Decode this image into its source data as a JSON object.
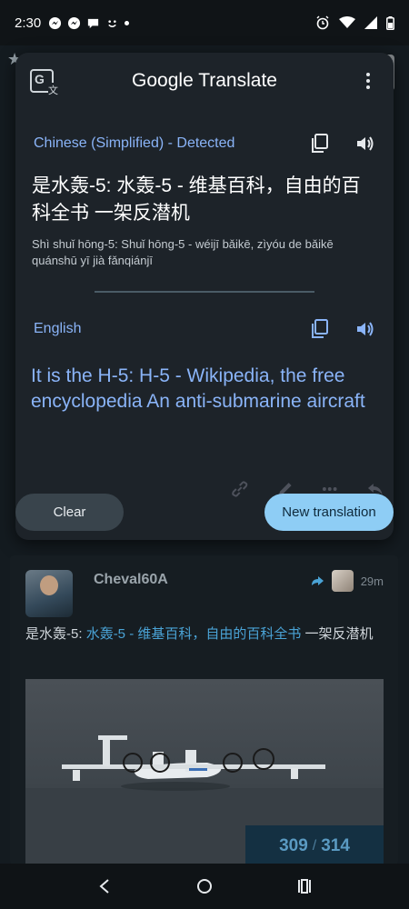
{
  "status_bar": {
    "time": "2:30"
  },
  "translate": {
    "app_name_bold": "Google",
    "app_name_rest": " Translate",
    "source_language": "Chinese (Simplified) - Detected",
    "source_text": "是水轰-5: 水轰-5 - 维基百科，自由的百科全书 一架反潜机",
    "pinyin": "Shì shuǐ hōng-5: Shuǐ hōng-5 - wéijī bǎikē, zìyóu de bǎikē quánshū yī jià fǎnqiánjī",
    "target_language": "English",
    "target_text": "It is the H-5: H-5 - Wikipedia, the free encyclopedia An anti-submarine aircraft"
  },
  "buttons": {
    "clear": "Clear",
    "new_translation": "New translation"
  },
  "post": {
    "username": "Cheval60A",
    "time": "29m",
    "text_prefix": "是水轰-5: ",
    "text_link": "水轰-5 - 维基百科，自由的百科全书",
    "text_suffix": " 一架反潜机",
    "image_counter_current": "309",
    "image_counter_total": "314"
  },
  "colors": {
    "accent_blue": "#8ab4f8",
    "button_primary": "#8ecdf5",
    "card_bg": "#1d2329"
  }
}
